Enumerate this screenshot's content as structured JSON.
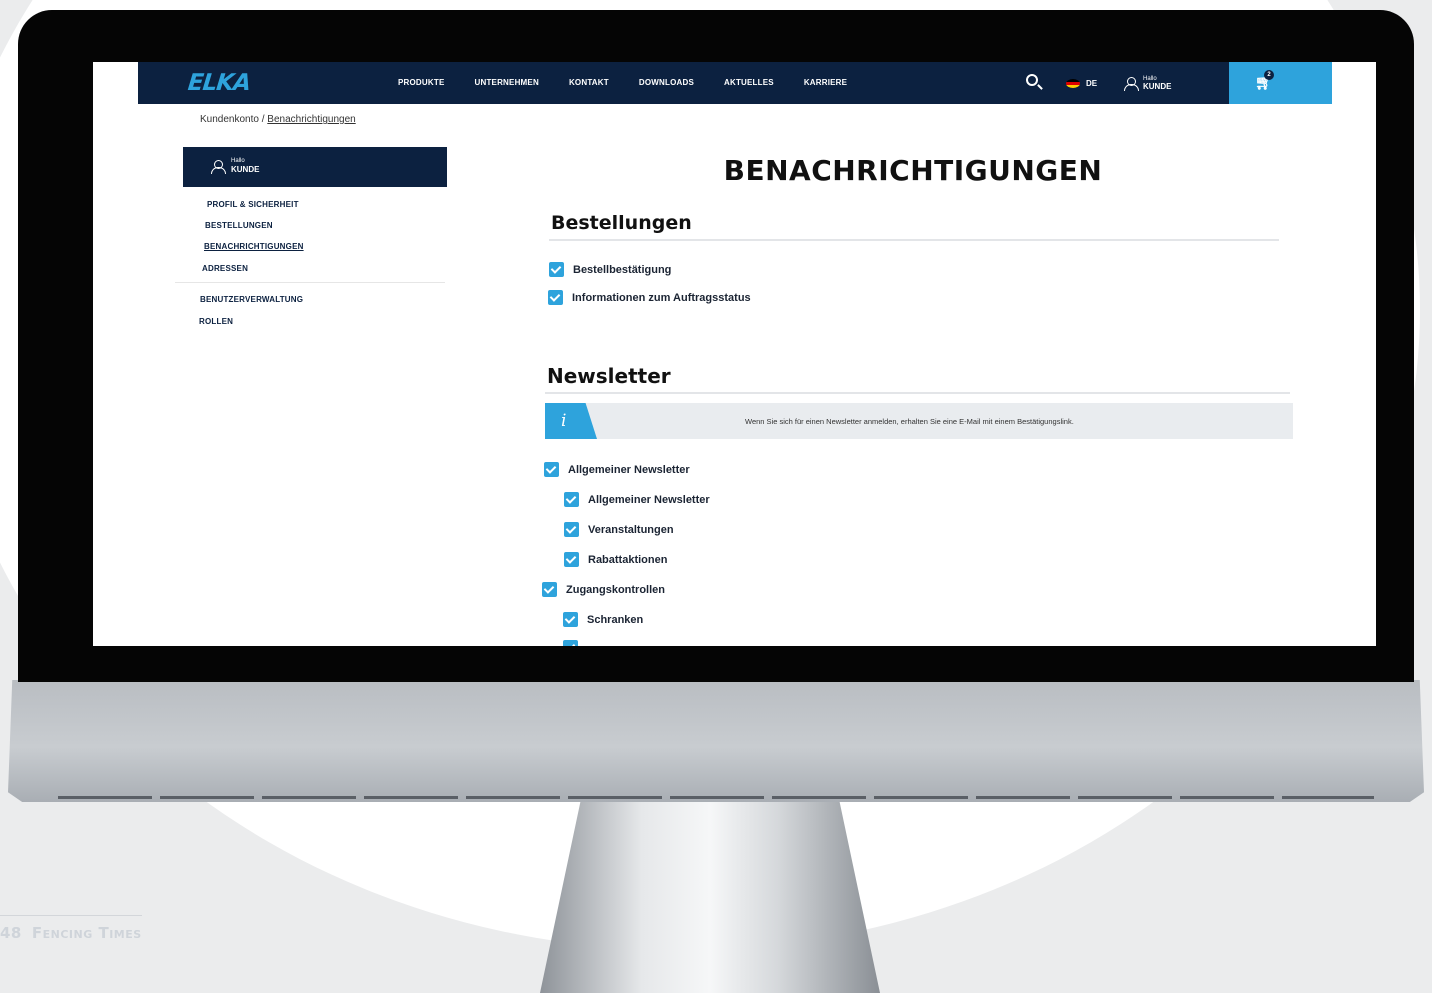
{
  "header": {
    "logo": "ELKA",
    "nav": [
      "PRODUKTE",
      "UNTERNEHMEN",
      "KONTAKT",
      "DOWNLOADS",
      "AKTUELLES",
      "KARRIERE"
    ],
    "lang": "DE",
    "hello": "Hallo",
    "user": "KUNDE",
    "cart_count": "2"
  },
  "breadcrumb": {
    "root": "Kundenkonto",
    "sep": " / ",
    "current": "Benachrichtigungen"
  },
  "sidebar": {
    "hello": "Hallo",
    "user": "KUNDE",
    "items": [
      "PROFIL & SICHERHEIT",
      "BESTELLUNGEN",
      "BENACHRICHTIGUNGEN",
      "ADRESSEN"
    ],
    "items2": [
      "BENUTZERVERWALTUNG",
      "ROLLEN"
    ]
  },
  "main": {
    "title": "BENACHRICHTIGUNGEN",
    "orders": {
      "title": "Bestellungen",
      "options": [
        "Bestellbestätigung",
        "Informationen zum Auftragsstatus"
      ]
    },
    "newsletter": {
      "title": "Newsletter",
      "info": "Wenn Sie sich für einen Newsletter anmelden, erhalten Sie eine E-Mail mit einem Bestätigungslink.",
      "options": [
        "Allgemeiner Newsletter",
        "Allgemeiner Newsletter",
        "Veranstaltungen",
        "Rabattaktionen",
        "Zugangskontrollen",
        "Schranken"
      ]
    }
  },
  "footer": {
    "page": "48",
    "title": "Fencing Times"
  },
  "colors": {
    "navy": "#0c2140",
    "accent": "#2ea3dc"
  }
}
